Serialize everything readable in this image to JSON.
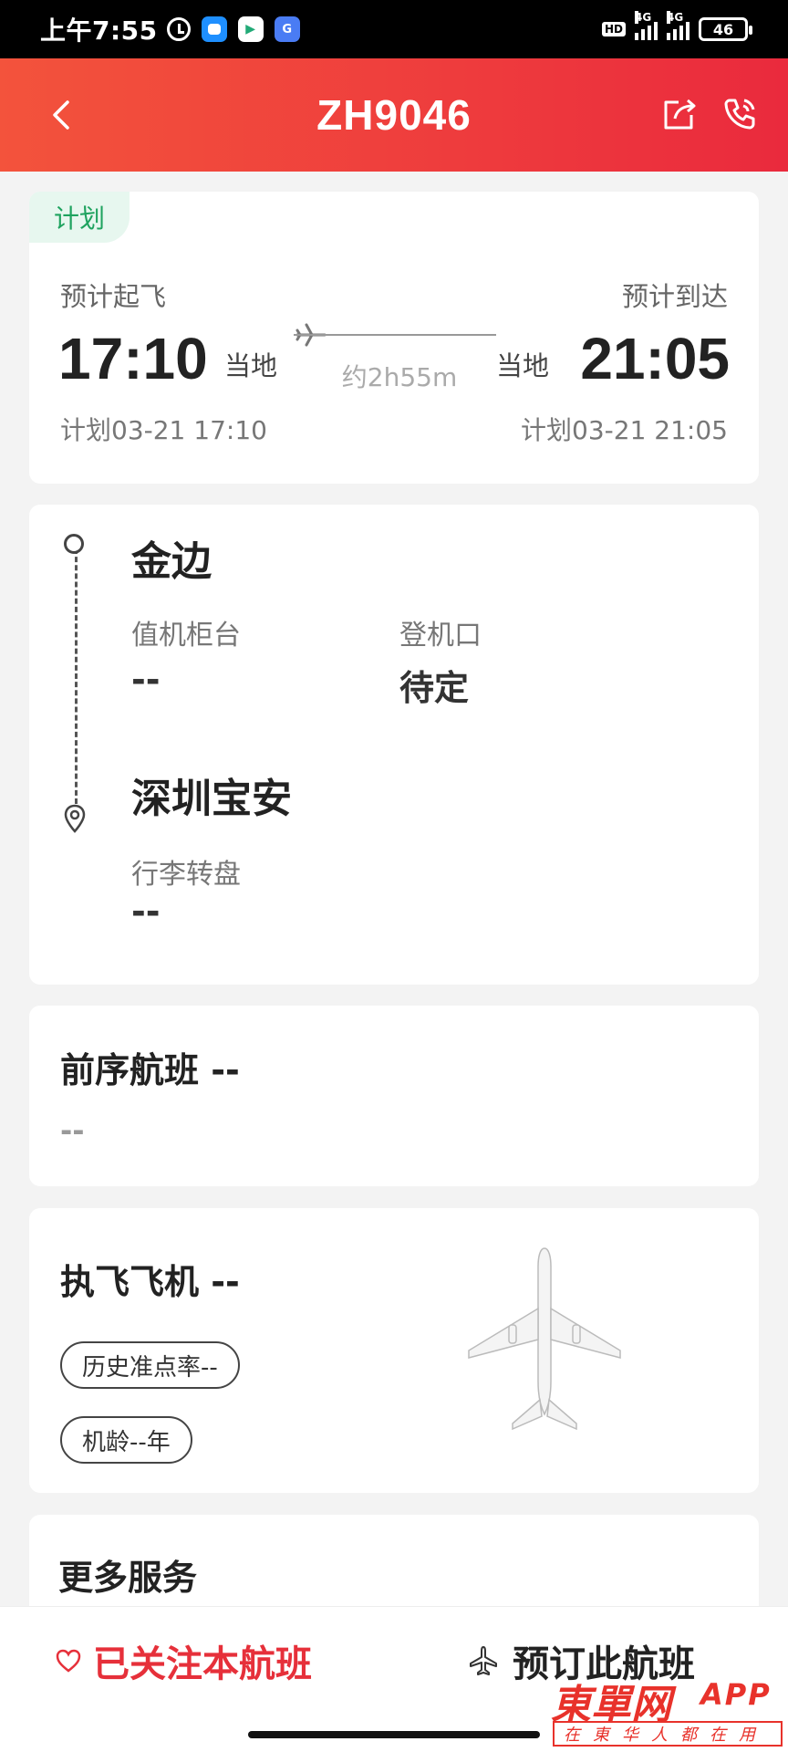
{
  "status_bar": {
    "time": "上午7:55",
    "hd": "HD",
    "net1": "4G",
    "net2": "4G",
    "battery": "46"
  },
  "header": {
    "title": "ZH9046"
  },
  "schedule": {
    "badge": "计划",
    "depart_label": "预计起飞",
    "arrive_label": "预计到达",
    "depart_time": "17:10",
    "arrive_time": "21:05",
    "depart_local": "当地",
    "arrive_local": "当地",
    "duration": "约2h55m",
    "depart_plan": "计划03-21 17:10",
    "arrive_plan": "计划03-21 21:05"
  },
  "route": {
    "origin": "金边",
    "checkin_label": "值机柜台",
    "checkin_value": "--",
    "gate_label": "登机口",
    "gate_value": "待定",
    "destination": "深圳宝安",
    "baggage_label": "行李转盘",
    "baggage_value": "--"
  },
  "previous_flight": {
    "title": "前序航班 --",
    "value": "--"
  },
  "aircraft": {
    "title": "执飞飞机 --",
    "ontime": "历史准点率--",
    "age": "机龄--年"
  },
  "more_services": {
    "title": "更多服务"
  },
  "bottom": {
    "follow": "已关注本航班",
    "book": "预订此航班"
  },
  "watermark": {
    "main": "東單网",
    "app": "APP",
    "sub": "在東华人都在用"
  },
  "colors": {
    "header_red": "#ee3b3d",
    "follow_red": "#e6303a",
    "plan_green": "#1fa35f"
  }
}
